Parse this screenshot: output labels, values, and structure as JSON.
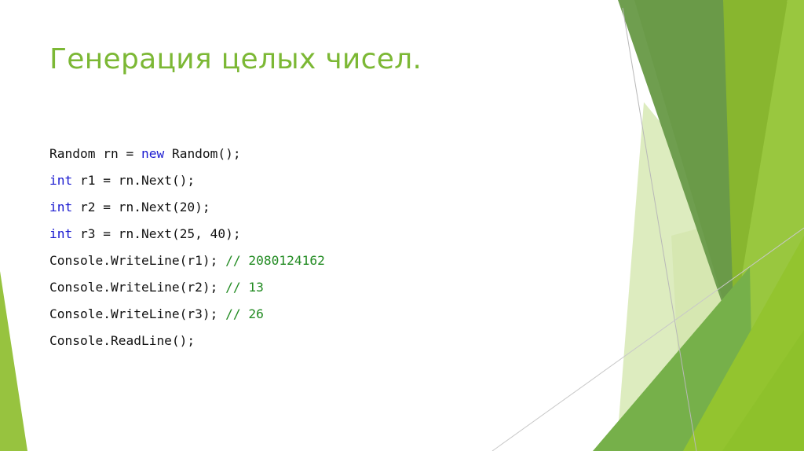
{
  "slide": {
    "title": "Генерация целых чисел.",
    "code_lines": [
      {
        "pre": "Random rn = ",
        "keyword": "new",
        "post": " Random();",
        "comment": ""
      },
      {
        "pre": "",
        "keyword": "int",
        "post": " r1 = rn.Next();",
        "comment": ""
      },
      {
        "pre": "",
        "keyword": "int",
        "post": " r2 = rn.Next(20);",
        "comment": ""
      },
      {
        "pre": "",
        "keyword": "int",
        "post": " r3 = rn.Next(25, 40);",
        "comment": ""
      },
      {
        "pre": "Console.WriteLine(r1); ",
        "keyword": "",
        "post": "",
        "comment": "// 2080124162"
      },
      {
        "pre": "Console.WriteLine(r2); ",
        "keyword": "",
        "post": "",
        "comment": "// 13"
      },
      {
        "pre": "Console.WriteLine(r3); ",
        "keyword": "",
        "post": "",
        "comment": "// 26"
      },
      {
        "pre": "Console.ReadLine();",
        "keyword": "",
        "post": "",
        "comment": ""
      }
    ]
  },
  "theme": {
    "title_color": "#7cb835",
    "keyword_color": "#1a1ad0",
    "comment_color": "#228b22",
    "text_color": "#111111"
  }
}
